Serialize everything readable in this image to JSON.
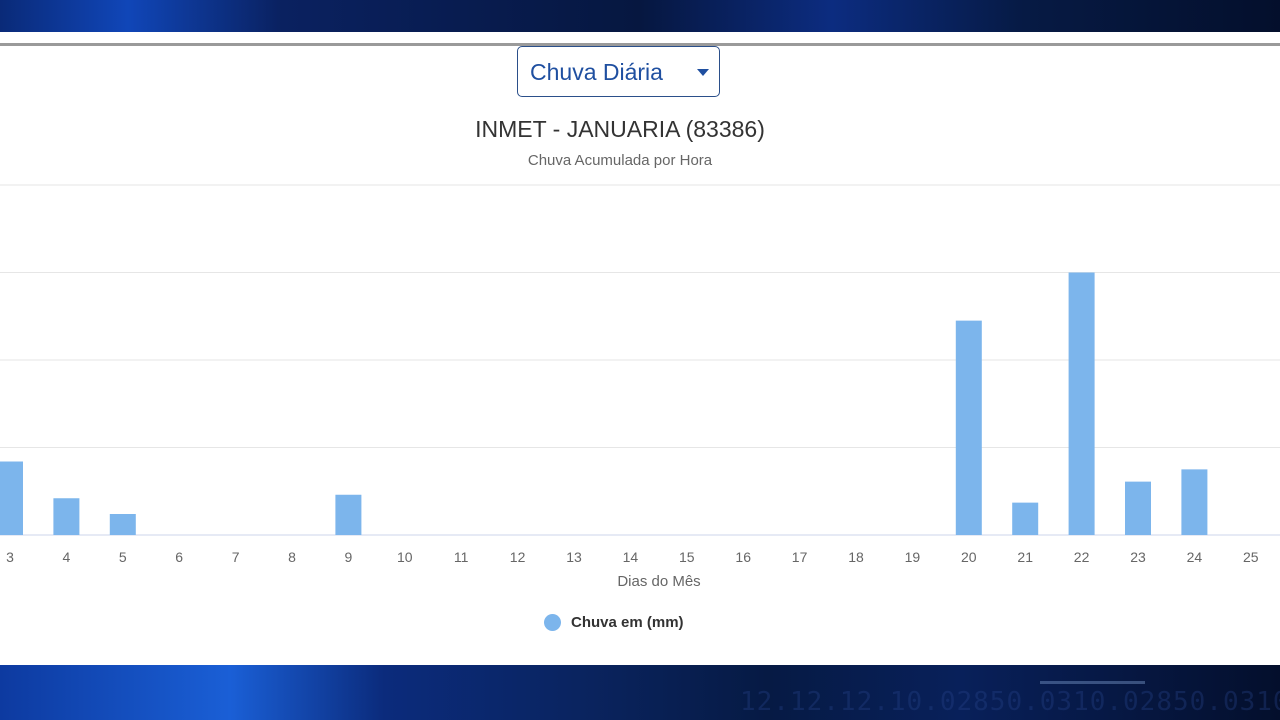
{
  "dropdown": {
    "selected": "Chuva Diária"
  },
  "colors": {
    "bar": "#7cb5ec",
    "grid": "#e6e6e6",
    "axis_text": "#666666",
    "title": "#333333"
  },
  "chart_data": {
    "type": "bar",
    "title": "INMET - JANUARIA (83386)",
    "subtitle": "Chuva Acumulada por Hora",
    "xlabel": "Dias do Mês",
    "ylabel": "",
    "grid": true,
    "legend_position": "bottom-center",
    "ylim": [
      0,
      40
    ],
    "categories": [
      "3",
      "4",
      "5",
      "6",
      "7",
      "8",
      "9",
      "10",
      "11",
      "12",
      "13",
      "14",
      "15",
      "16",
      "17",
      "18",
      "19",
      "20",
      "21",
      "22",
      "23",
      "24",
      "25"
    ],
    "series": [
      {
        "name": "Chuva em (mm)",
        "values": [
          8.4,
          4.2,
          2.4,
          0,
          0,
          0,
          4.6,
          0,
          0,
          0,
          0,
          0,
          0,
          0,
          0,
          0,
          0,
          24.5,
          3.7,
          30,
          6.1,
          7.5,
          0
        ]
      }
    ]
  }
}
